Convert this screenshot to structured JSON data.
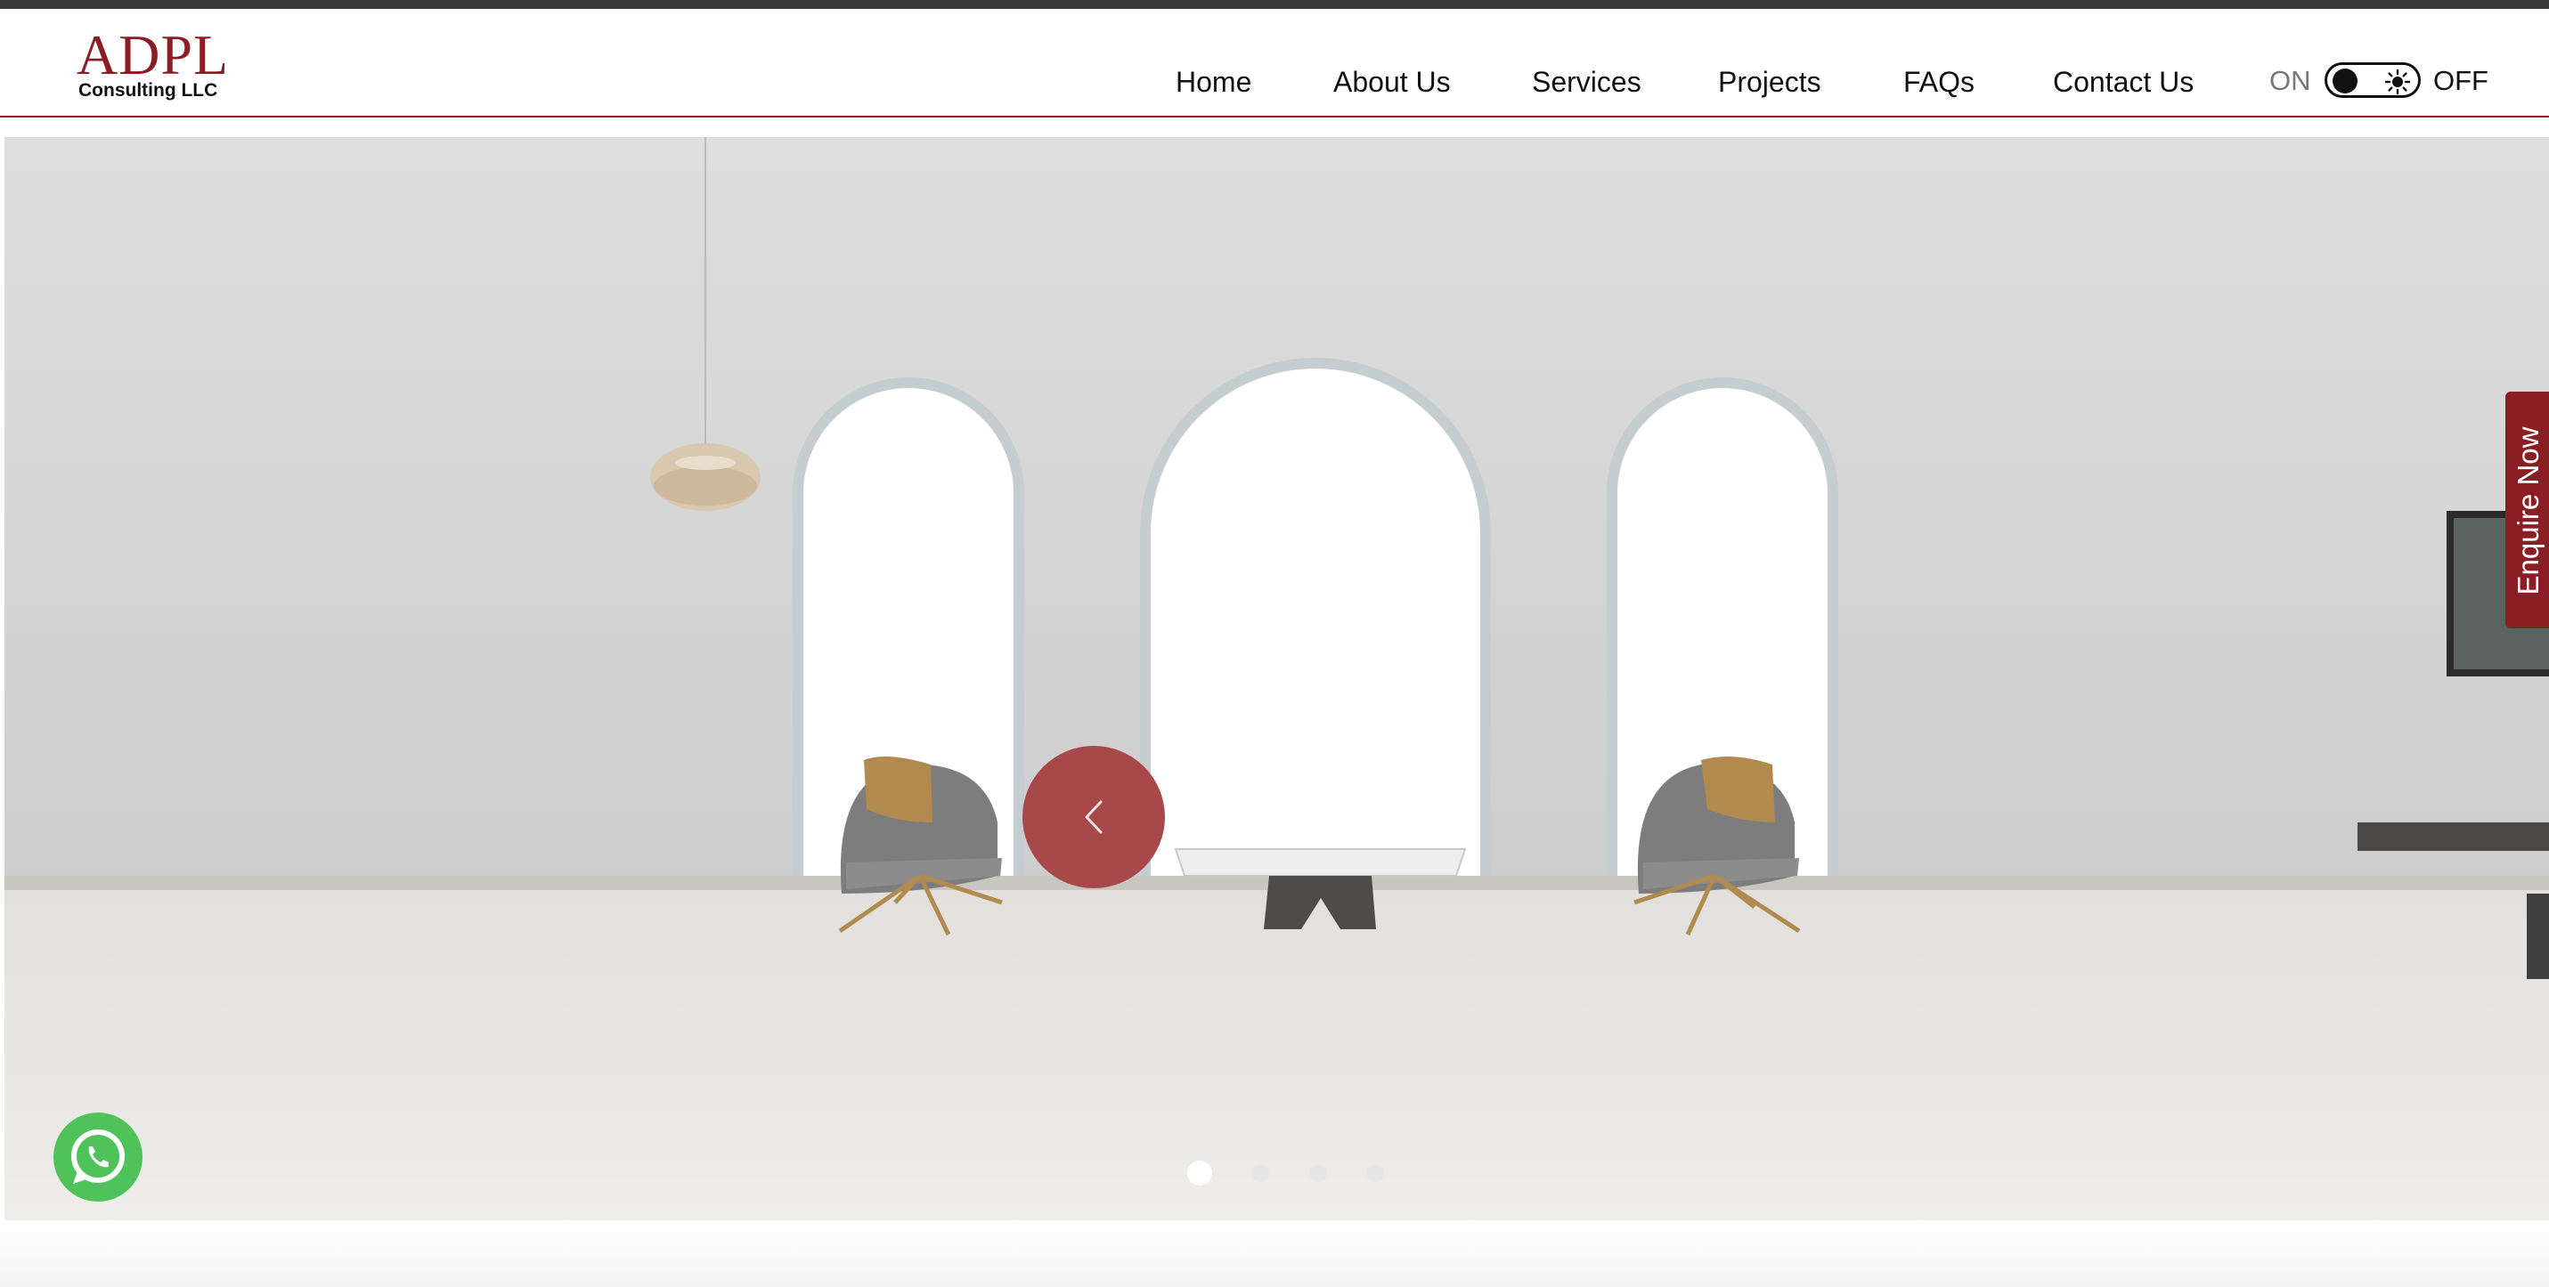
{
  "brand": {
    "logo_main": "ADPL",
    "logo_sub": "Consulting LLC",
    "accent_color": "#8b1e24"
  },
  "nav": {
    "items": [
      {
        "label": "Home"
      },
      {
        "label": "About Us"
      },
      {
        "label": "Services"
      },
      {
        "label": "Projects"
      },
      {
        "label": "FAQs"
      },
      {
        "label": "Contact Us"
      }
    ]
  },
  "theme_toggle": {
    "on_label": "ON",
    "off_label": "OFF",
    "icon": "sun-icon"
  },
  "hero": {
    "slide_count": 4,
    "active_slide": 1,
    "prev_icon": "chevron-left-icon",
    "button_color": "#a8484b"
  },
  "enquire": {
    "label": "Enquire Now"
  },
  "whatsapp": {
    "icon": "whatsapp-icon",
    "color": "#4fc25a"
  }
}
